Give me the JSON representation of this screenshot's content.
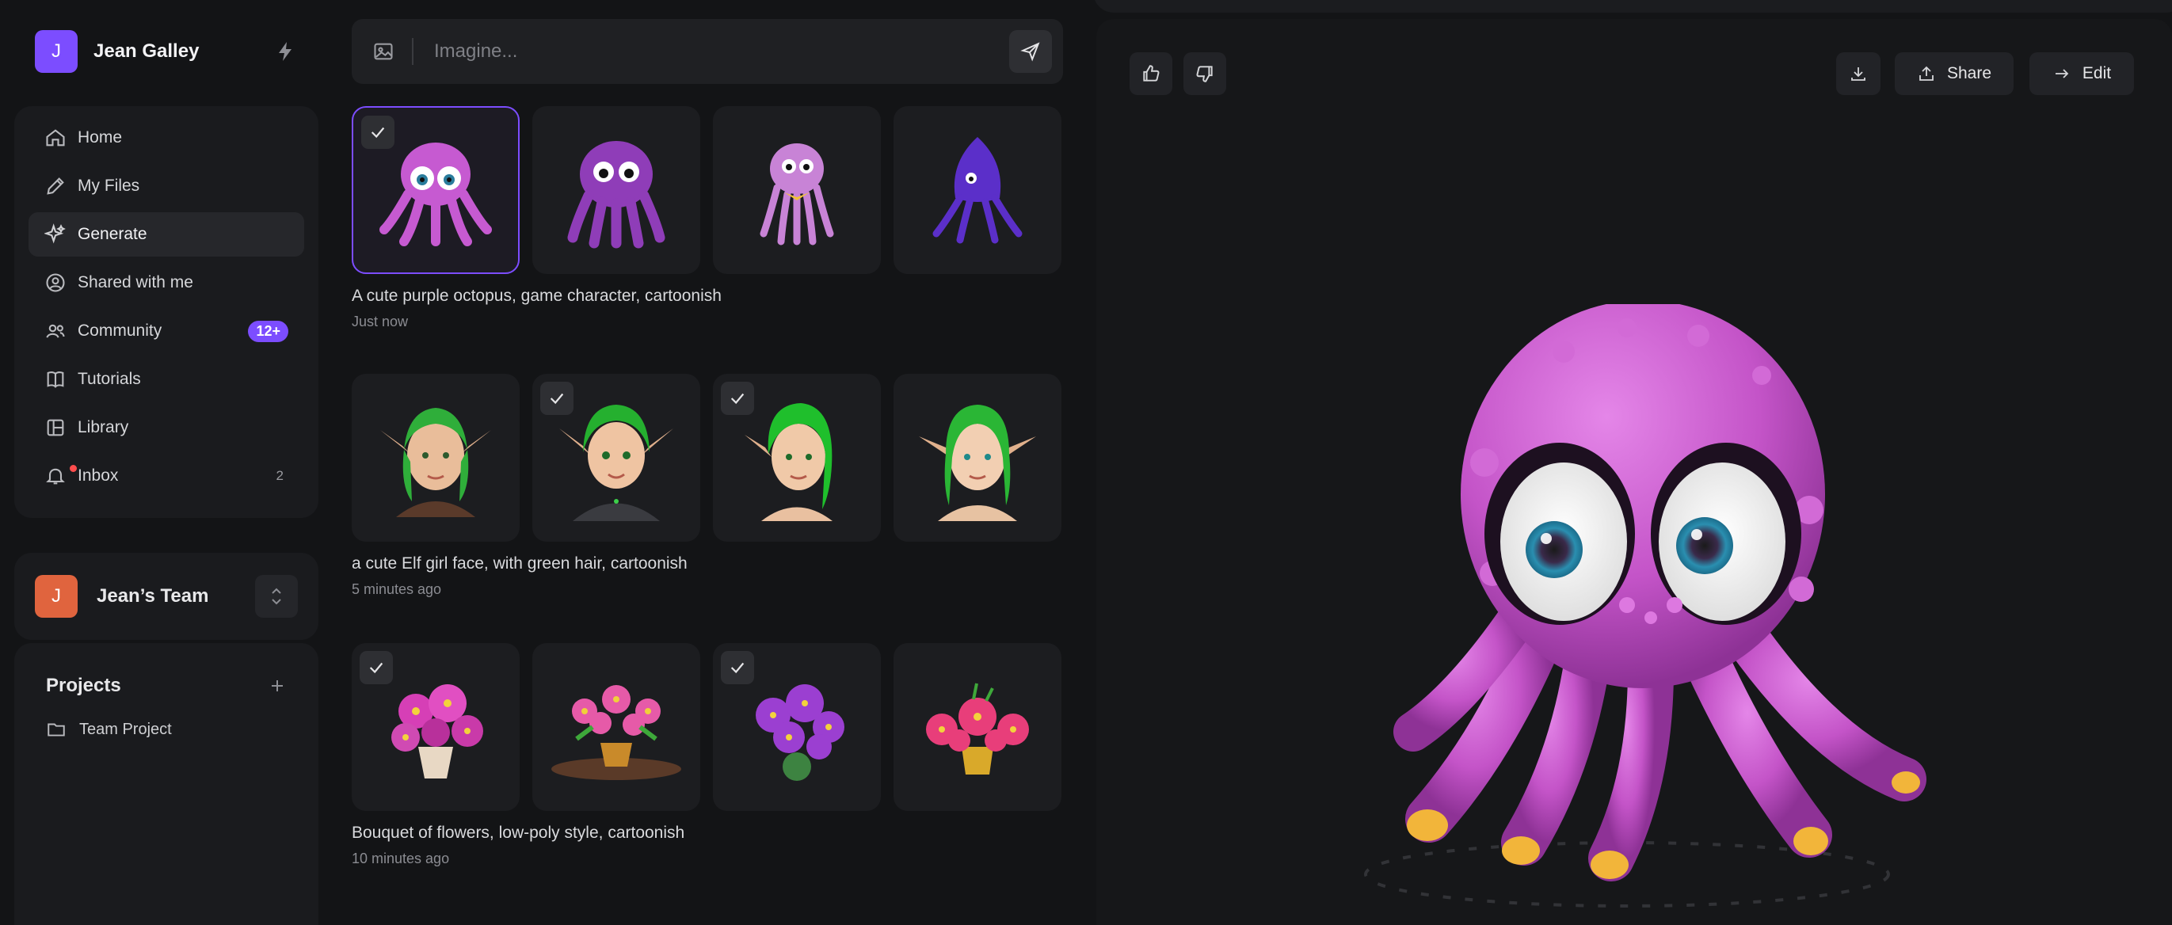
{
  "user": {
    "initial": "J",
    "name": "Jean Galley"
  },
  "nav": [
    {
      "label": "Home",
      "icon": "home-icon"
    },
    {
      "label": "My Files",
      "icon": "pencil-icon"
    },
    {
      "label": "Generate",
      "icon": "sparkles-icon",
      "active": true
    },
    {
      "label": "Shared with me",
      "icon": "user-circle-icon"
    },
    {
      "label": "Community",
      "icon": "users-icon",
      "badge": "12+"
    },
    {
      "label": "Tutorials",
      "icon": "book-icon"
    },
    {
      "label": "Library",
      "icon": "layout-icon"
    },
    {
      "label": "Inbox",
      "icon": "bell-icon",
      "count": "2"
    }
  ],
  "team": {
    "initial": "J",
    "name": "Jean’s Team"
  },
  "projects": {
    "title": "Projects",
    "items": [
      {
        "label": "Team Project"
      }
    ]
  },
  "prompt": {
    "placeholder": "Imagine..."
  },
  "generations": [
    {
      "caption": "A cute purple octopus, game character, cartoonish",
      "time": "Just now",
      "thumbs": [
        {
          "checked": true,
          "selected": true
        },
        {
          "checked": false
        },
        {
          "checked": false
        },
        {
          "checked": false
        }
      ]
    },
    {
      "caption": "a cute Elf girl face, with green hair, cartoonish",
      "time": "5 minutes ago",
      "thumbs": [
        {
          "checked": false
        },
        {
          "checked": true
        },
        {
          "checked": true
        },
        {
          "checked": false
        }
      ]
    },
    {
      "caption": "Bouquet of flowers, low-poly style, cartoonish",
      "time": "10 minutes ago",
      "thumbs": [
        {
          "checked": true
        },
        {
          "checked": false
        },
        {
          "checked": true
        },
        {
          "checked": false
        }
      ]
    }
  ],
  "preview": {
    "share_label": "Share",
    "edit_label": "Edit"
  },
  "colors": {
    "accent": "#7c4dff",
    "team": "#e0643e",
    "octopus": "#c65ad1"
  }
}
